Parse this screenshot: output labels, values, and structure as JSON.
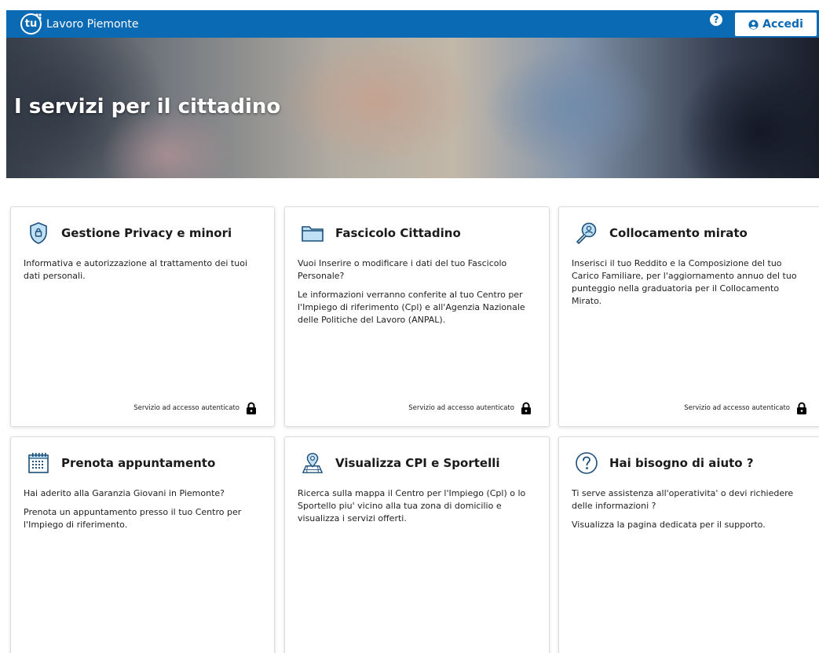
{
  "header": {
    "logo_mark": "tu",
    "brand": "Lavoro Piemonte",
    "help_symbol": "?",
    "login_label": "Accedi",
    "bg_color": "#0a6ab3"
  },
  "hero": {
    "title": "I servizi per il cittadino"
  },
  "cards": [
    {
      "icon": "shield-lock-icon",
      "title": "Gestione Privacy e minori",
      "paragraphs": [
        "Informativa e autorizzazione al trattamento dei tuoi dati personali."
      ],
      "footer": "Servizio ad accesso autenticato"
    },
    {
      "icon": "folder-icon",
      "title": "Fascicolo Cittadino",
      "paragraphs": [
        "Vuoi Inserire o modificare i dati del tuo Fascicolo Personale?",
        "Le informazioni verranno conferite al tuo Centro per l'Impiego di riferimento (Cpl) e all'Agenzia Nazionale delle Politiche del Lavoro (ANPAL)."
      ],
      "footer": "Servizio ad accesso autenticato"
    },
    {
      "icon": "person-search-icon",
      "title": "Collocamento mirato",
      "paragraphs": [
        "Inserisci il tuo Reddito e la Composizione del tuo Carico Familiare, per l'aggiornamento annuo del tuo punteggio nella graduatoria per il Collocamento Mirato."
      ],
      "footer": "Servizio ad accesso autenticato"
    },
    {
      "icon": "calendar-icon",
      "title": "Prenota appuntamento",
      "paragraphs": [
        "Hai aderito alla Garanzia Giovani in Piemonte?",
        "Prenota un appuntamento presso il tuo Centro per l'Impiego di riferimento."
      ]
    },
    {
      "icon": "map-pin-icon",
      "title": "Visualizza CPI e Sportelli",
      "paragraphs": [
        "Ricerca sulla mappa il Centro per l'Impiego (Cpl) o lo Sportello piu' vicino alla tua zona di domicilio e visualizza i servizi offerti."
      ]
    },
    {
      "icon": "help-circle-icon",
      "title": "Hai bisogno di aiuto ?",
      "paragraphs": [
        "Ti serve assistenza all'operativita' o devi richiedere delle informazioni ?",
        "Visualizza la pagina dedicata per il supporto."
      ]
    }
  ]
}
